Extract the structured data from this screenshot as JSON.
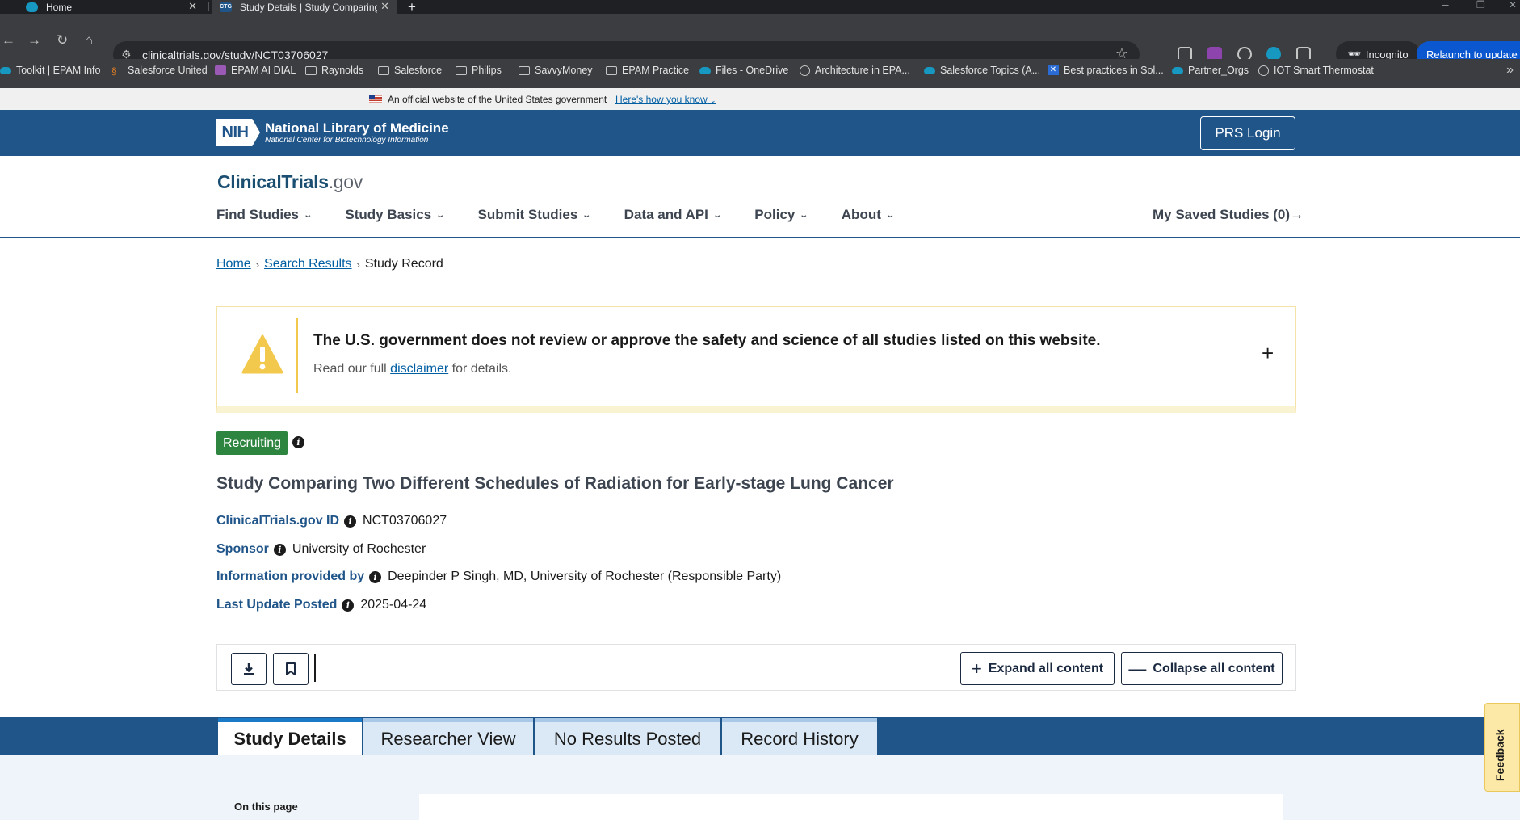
{
  "browser": {
    "tabs": [
      {
        "title": "Home",
        "active": false
      },
      {
        "title": "Study Details | Study Comparing",
        "active": true
      }
    ],
    "new_tab": "+",
    "url": "clinicaltrials.gov/study/NCT03706027",
    "incognito_label": "Incognito",
    "relaunch_label": "Relaunch to update",
    "bookmarks": [
      "Toolkit | EPAM Info",
      "Salesforce United",
      "EPAM AI DIAL",
      "Raynolds",
      "Salesforce",
      "Philips",
      "SavvyMoney",
      "EPAM Practice",
      "Files - OneDrive",
      "Architecture in EPA...",
      "Salesforce Topics (A...",
      "Best practices in Sol...",
      "Partner_Orgs",
      "IOT Smart Thermostat"
    ]
  },
  "gov_banner": {
    "text": "An official website of the United States government",
    "link": "Here's how you know"
  },
  "nih": {
    "badge": "NIH",
    "name": "National Library of Medicine",
    "subname": "National Center for Biotechnology Information",
    "login": "PRS Login"
  },
  "site": {
    "logo_main": "ClinicalTrials",
    "logo_suffix": ".gov",
    "nav": [
      "Find Studies",
      "Study Basics",
      "Submit Studies",
      "Data and API",
      "Policy",
      "About"
    ],
    "saved_studies": "My Saved Studies (0)"
  },
  "breadcrumb": {
    "home": "Home",
    "search": "Search Results",
    "current": "Study Record"
  },
  "disclaimer": {
    "title": "The U.S. government does not review or approve the safety and science of all studies listed on this website.",
    "sub_before": "Read our full ",
    "sub_link": "disclaimer",
    "sub_after": " for details."
  },
  "study": {
    "status": "Recruiting",
    "title": "Study Comparing Two Different Schedules of Radiation for Early-stage Lung Cancer",
    "meta": [
      {
        "label": "ClinicalTrials.gov ID",
        "value": "NCT03706027"
      },
      {
        "label": "Sponsor",
        "value": "University of Rochester"
      },
      {
        "label": "Information provided by",
        "value": "Deepinder P Singh, MD, University of Rochester (Responsible Party)"
      },
      {
        "label": "Last Update Posted",
        "value": "2025-04-24"
      }
    ]
  },
  "actions": {
    "expand": "Expand all content",
    "collapse": "Collapse all content"
  },
  "tabs": [
    "Study Details",
    "Researcher View",
    "No Results Posted",
    "Record History"
  ],
  "on_this_page": "On this page",
  "feedback": "Feedback",
  "colors": {
    "nih_blue": "#20558a",
    "recruiting_green": "#2e8540",
    "link_blue": "#005ea2",
    "warning_yellow": "#f2c94c"
  }
}
